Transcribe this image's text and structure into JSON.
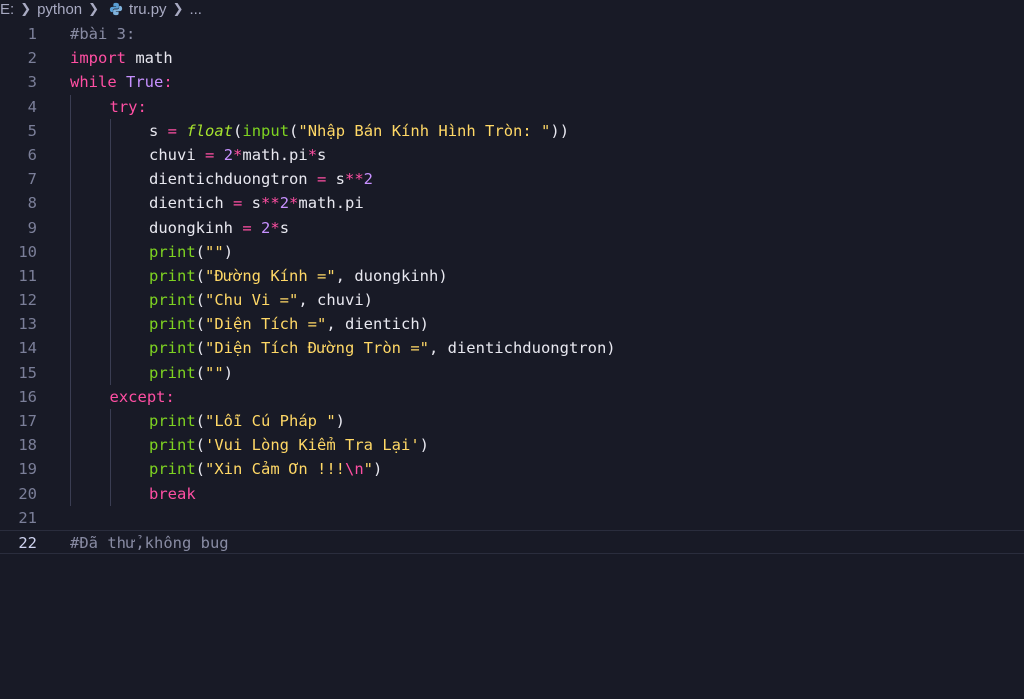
{
  "breadcrumb": {
    "drive": "E:",
    "folder": "python",
    "file": "tru.py",
    "more": "..."
  },
  "active_line": 22,
  "lines": [
    {
      "n": "1",
      "indent": 0,
      "tokens": [
        [
          "cmt",
          "#bài 3:"
        ]
      ]
    },
    {
      "n": "2",
      "indent": 0,
      "tokens": [
        [
          "kw",
          "import"
        ],
        [
          "plain",
          " math"
        ]
      ]
    },
    {
      "n": "3",
      "indent": 0,
      "tokens": [
        [
          "kw",
          "while"
        ],
        [
          "plain",
          " "
        ],
        [
          "kw2",
          "True"
        ],
        [
          "kw",
          ":"
        ]
      ]
    },
    {
      "n": "4",
      "indent": 1,
      "tokens": [
        [
          "kw",
          "try"
        ],
        [
          "kw",
          ":"
        ]
      ]
    },
    {
      "n": "5",
      "indent": 2,
      "tokens": [
        [
          "plain",
          "s "
        ],
        [
          "op",
          "="
        ],
        [
          "plain",
          " "
        ],
        [
          "fni",
          "float"
        ],
        [
          "punc",
          "("
        ],
        [
          "fn",
          "input"
        ],
        [
          "punc",
          "("
        ],
        [
          "str",
          "\"Nhập Bán Kính Hình Tròn: \""
        ],
        [
          "punc",
          "))"
        ]
      ]
    },
    {
      "n": "6",
      "indent": 2,
      "tokens": [
        [
          "plain",
          "chuvi "
        ],
        [
          "op",
          "="
        ],
        [
          "plain",
          " "
        ],
        [
          "num",
          "2"
        ],
        [
          "op",
          "*"
        ],
        [
          "plain",
          "math.pi"
        ],
        [
          "op",
          "*"
        ],
        [
          "plain",
          "s"
        ]
      ]
    },
    {
      "n": "7",
      "indent": 2,
      "tokens": [
        [
          "plain",
          "dientichduongtron "
        ],
        [
          "op",
          "="
        ],
        [
          "plain",
          " s"
        ],
        [
          "op",
          "**"
        ],
        [
          "num",
          "2"
        ]
      ]
    },
    {
      "n": "8",
      "indent": 2,
      "tokens": [
        [
          "plain",
          "dientich "
        ],
        [
          "op",
          "="
        ],
        [
          "plain",
          " s"
        ],
        [
          "op",
          "**"
        ],
        [
          "num",
          "2"
        ],
        [
          "op",
          "*"
        ],
        [
          "plain",
          "math.pi"
        ]
      ]
    },
    {
      "n": "9",
      "indent": 2,
      "tokens": [
        [
          "plain",
          "duongkinh "
        ],
        [
          "op",
          "="
        ],
        [
          "plain",
          " "
        ],
        [
          "num",
          "2"
        ],
        [
          "op",
          "*"
        ],
        [
          "plain",
          "s"
        ]
      ]
    },
    {
      "n": "10",
      "indent": 2,
      "tokens": [
        [
          "fn",
          "print"
        ],
        [
          "punc",
          "("
        ],
        [
          "str",
          "\"\""
        ],
        [
          "punc",
          ")"
        ]
      ]
    },
    {
      "n": "11",
      "indent": 2,
      "tokens": [
        [
          "fn",
          "print"
        ],
        [
          "punc",
          "("
        ],
        [
          "str",
          "\"Đường Kính =\""
        ],
        [
          "punc",
          ", duongkinh)"
        ]
      ]
    },
    {
      "n": "12",
      "indent": 2,
      "tokens": [
        [
          "fn",
          "print"
        ],
        [
          "punc",
          "("
        ],
        [
          "str",
          "\"Chu Vi =\""
        ],
        [
          "punc",
          ", chuvi)"
        ]
      ]
    },
    {
      "n": "13",
      "indent": 2,
      "tokens": [
        [
          "fn",
          "print"
        ],
        [
          "punc",
          "("
        ],
        [
          "str",
          "\"Diện Tích =\""
        ],
        [
          "punc",
          ", dientich)"
        ]
      ]
    },
    {
      "n": "14",
      "indent": 2,
      "tokens": [
        [
          "fn",
          "print"
        ],
        [
          "punc",
          "("
        ],
        [
          "str",
          "\"Diện Tích Đường Tròn =\""
        ],
        [
          "punc",
          ", dientichduongtron)"
        ]
      ]
    },
    {
      "n": "15",
      "indent": 2,
      "tokens": [
        [
          "fn",
          "print"
        ],
        [
          "punc",
          "("
        ],
        [
          "str",
          "\"\""
        ],
        [
          "punc",
          ")"
        ]
      ]
    },
    {
      "n": "16",
      "indent": 1,
      "tokens": [
        [
          "kw",
          "except"
        ],
        [
          "kw",
          ":"
        ]
      ]
    },
    {
      "n": "17",
      "indent": 2,
      "tokens": [
        [
          "fn",
          "print"
        ],
        [
          "punc",
          "("
        ],
        [
          "str",
          "\"Lỗi Cú Pháp \""
        ],
        [
          "punc",
          ")"
        ]
      ]
    },
    {
      "n": "18",
      "indent": 2,
      "tokens": [
        [
          "fn",
          "print"
        ],
        [
          "punc",
          "("
        ],
        [
          "str",
          "'Vui Lòng Kiểm Tra Lại'"
        ],
        [
          "punc",
          ")"
        ]
      ]
    },
    {
      "n": "19",
      "indent": 2,
      "tokens": [
        [
          "fn",
          "print"
        ],
        [
          "punc",
          "("
        ],
        [
          "str",
          "\"Xin Cảm Ơn !!!"
        ],
        [
          "esc",
          "\\n"
        ],
        [
          "str",
          "\""
        ],
        [
          "punc",
          ")"
        ]
      ]
    },
    {
      "n": "20",
      "indent": 2,
      "tokens": [
        [
          "kw",
          "break"
        ]
      ]
    },
    {
      "n": "21",
      "indent": 0,
      "tokens": []
    },
    {
      "n": "22",
      "indent": 0,
      "tokens": [
        [
          "cmt",
          "#Đã thử,không bug"
        ]
      ]
    }
  ],
  "colors": {
    "background": "#181a26",
    "keyword": "#ff4fa3",
    "builtin_constant": "#c791ff",
    "function": "#7ed321",
    "string": "#ffd866",
    "comment": "#888ba3"
  }
}
